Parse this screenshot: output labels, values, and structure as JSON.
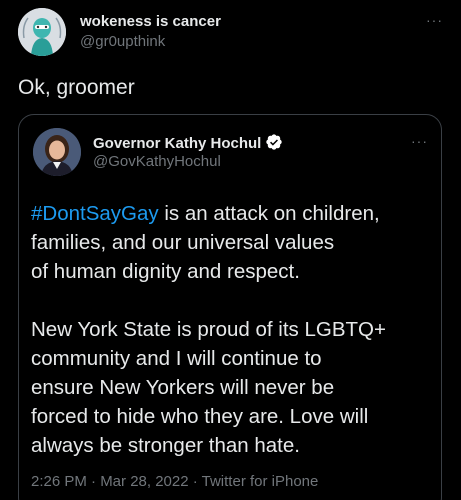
{
  "tweet": {
    "display_name": "wokeness is cancer",
    "handle": "@gr0upthink",
    "more": "···",
    "text": "Ok, groomer",
    "avatar_icon": "illustrated-avatar-icon"
  },
  "quoted_tweet": {
    "display_name": "Governor Kathy Hochul",
    "handle": "@GovKathyHochul",
    "verified_icon": "verified-badge-icon",
    "more": "···",
    "hashtag": "#DontSayGay",
    "line1_rest": " is an attack on children,",
    "line2": "families, and our universal values",
    "line3": "of human dignity and respect.",
    "line4": "New York State is proud of its LGBTQ+",
    "line5": "community and I will continue to",
    "line6": "ensure New Yorkers will never be",
    "line7": "forced to hide who they are. Love will",
    "line8": "always be stronger than hate.",
    "meta": "2:26 PM · Mar 28, 2022 · Twitter for iPhone"
  },
  "colors": {
    "background": "#000000",
    "text": "#e7e9ea",
    "secondary": "#71767b",
    "link": "#1d9bf0",
    "border": "#3a3f45"
  }
}
